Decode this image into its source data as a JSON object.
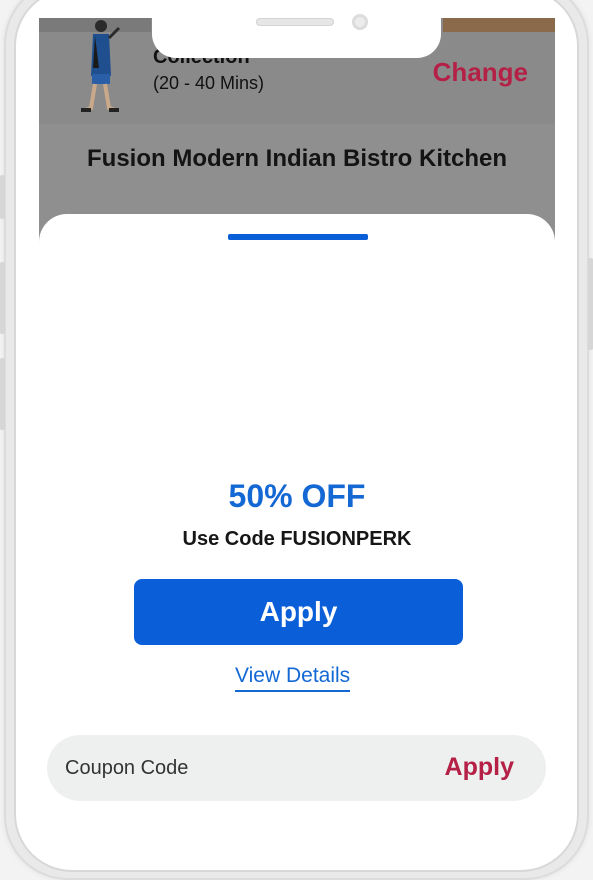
{
  "header": {
    "delivery_mode": "Collection",
    "delivery_time": "(20 - 40 Mins)",
    "change_label": "Change"
  },
  "restaurant": {
    "name": "Fusion Modern Indian Bistro Kitchen"
  },
  "offer": {
    "title": "50% OFF",
    "code_text": "Use Code FUSIONPERK",
    "apply_label": "Apply",
    "details_label": "View Details"
  },
  "coupon": {
    "placeholder": "Coupon Code",
    "apply_label": "Apply"
  },
  "colors": {
    "primary_blue": "#0a5fd9",
    "accent_red": "#b52046",
    "dim_overlay": "#8f8f8f"
  }
}
